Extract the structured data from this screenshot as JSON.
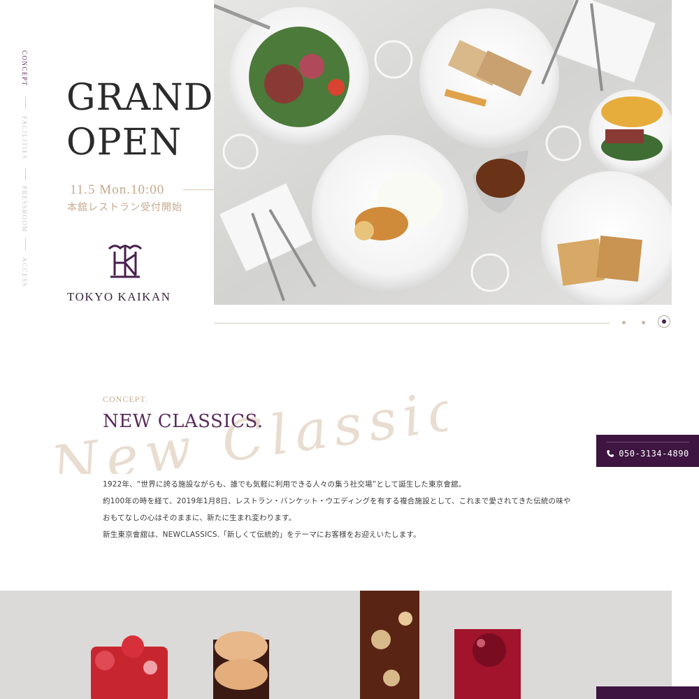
{
  "side_nav": {
    "items": [
      {
        "label": "CONCEPT",
        "active": true
      },
      {
        "label": "FACILITIES",
        "active": false
      },
      {
        "label": "PRESSROOM",
        "active": false
      },
      {
        "label": "ACCESS",
        "active": false
      }
    ]
  },
  "hero": {
    "title_line1": "GRAND",
    "title_line2": "OPEN",
    "date": "11.5 Mon.10:00",
    "subtitle": "本舘レストラン受付開始",
    "logo_text": "TOKYO KAIKAN"
  },
  "slider": {
    "slide_count": 3,
    "active_index": 3
  },
  "concept": {
    "label": "CONCEPT.",
    "title": "NEW CLASSICS.",
    "script_text": "New Classics.",
    "paragraphs": [
      "1922年、“世界に誇る施設ながらも、誰でも気軽に利用できる人々の集う社交場”として誕生した東京會舘。",
      "約100年の時を経て、2019年1月8日、レストラン・バンケット・ウエディングを有する複合施設として、これまで愛されてきた伝統の味や",
      "おもてなしの心はそのままに、新たに生まれ変わります。",
      "新生東京會舘は、NEWCLASSICS.「新しくて伝統的」をテーマにお客様をお迎えいたします。"
    ]
  },
  "contact": {
    "phone": "050-3134-4890",
    "icon": "phone-icon"
  },
  "colors": {
    "brand": "#3d1540",
    "accent_gold": "#c6a98d",
    "purple_text": "#5a2a5c"
  }
}
